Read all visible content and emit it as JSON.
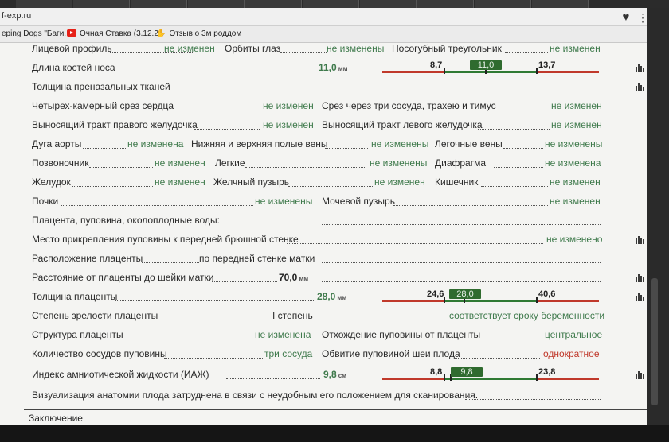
{
  "browser": {
    "url": "f-exp.ru",
    "bookmarks": [
      {
        "label": "eping Dogs \"Баги."
      },
      {
        "label": "Очная Ставка (3.12.2"
      },
      {
        "label": "Отзыв о 3м роддом"
      }
    ]
  },
  "rows": {
    "r1": {
      "l1": "Лицевой профиль",
      "v1": "не изменен",
      "l2": "Орбиты глаз",
      "v2": "не изменены",
      "l3": "Носогубный треугольник",
      "v3": "не изменен"
    },
    "r2": {
      "label": "Длина костей носа",
      "value": "11,0",
      "unit": "мм",
      "min": "8,7",
      "cur": "11,0",
      "max": "13,7"
    },
    "r3": {
      "label": "Толщина преназальных тканей"
    },
    "r4": {
      "l1": "Четырех-камерный срез сердца",
      "v1": "не изменен",
      "l2": "Срез через три сосуда, трахею и тимус",
      "v2": "не изменен"
    },
    "r5": {
      "l1": "Выносящий тракт правого желудочка",
      "v1": "не изменен",
      "l2": "Выносящий тракт левого желудочка",
      "v2": "не изменен"
    },
    "r6": {
      "l1": "Дуга аорты",
      "v1": "не изменена",
      "l2": "Нижняя и верхняя полые вены",
      "v2": "не изменены",
      "l3": "Легочные вены",
      "v3": "не изменены"
    },
    "r7": {
      "l1": "Позвоночник",
      "v1": "не изменен",
      "l2": "Легкие",
      "v2": "не изменены",
      "l3": "Диафрагма",
      "v3": "не изменена"
    },
    "r8": {
      "l1": "Желудок",
      "v1": "не изменен",
      "l2": "Желчный пузырь",
      "v2": "не изменен",
      "l3": "Кишечник",
      "v3": "не изменен"
    },
    "r9": {
      "l1": "Почки",
      "v1": "не изменены",
      "l2": "Мочевой пузырь",
      "v2": "не изменен"
    },
    "r10": {
      "label": "Плацента, пуповина, околоплодные воды:"
    },
    "r11": {
      "label": "Место прикрепления пуповины к передней брюшной стенке",
      "value": "не изменено"
    },
    "r12": {
      "label": "Расположение плаценты",
      "value": "по передней стенке матки"
    },
    "r13": {
      "label": "Расстояние от плаценты до шейки матки",
      "value": "70,0",
      "unit": "мм"
    },
    "r14": {
      "label": "Толщина плаценты",
      "value": "28,0",
      "unit": "мм",
      "min": "24,6",
      "cur": "28,0",
      "max": "40,6"
    },
    "r15": {
      "l1": "Степень зрелости плаценты",
      "v1": "I степень",
      "v2": "соответствует сроку беременности"
    },
    "r16": {
      "l1": "Структура плаценты",
      "v1": "не изменена",
      "l2": "Отхождение пуповины от плаценты",
      "v2": "центральное"
    },
    "r17": {
      "l1": "Количество сосудов пуповины",
      "v1": "три сосуда",
      "l2": "Обвитие пуповиной шеи плода",
      "v2": "однократное"
    },
    "r18": {
      "label": "Индекс амниотической жидкости (ИАЖ)",
      "value": "9,8",
      "unit": "см",
      "min": "8,8",
      "cur": "9,8",
      "max": "23,8"
    },
    "r19": {
      "label": "Визуализация анатомии плода затруднена в связи с неудобным его положением для сканирования."
    }
  },
  "conclusion": "Заключение",
  "colors": {
    "scale_red": "#c0392b",
    "scale_green": "#2f7a34",
    "value_green": "#3f7a4c"
  }
}
